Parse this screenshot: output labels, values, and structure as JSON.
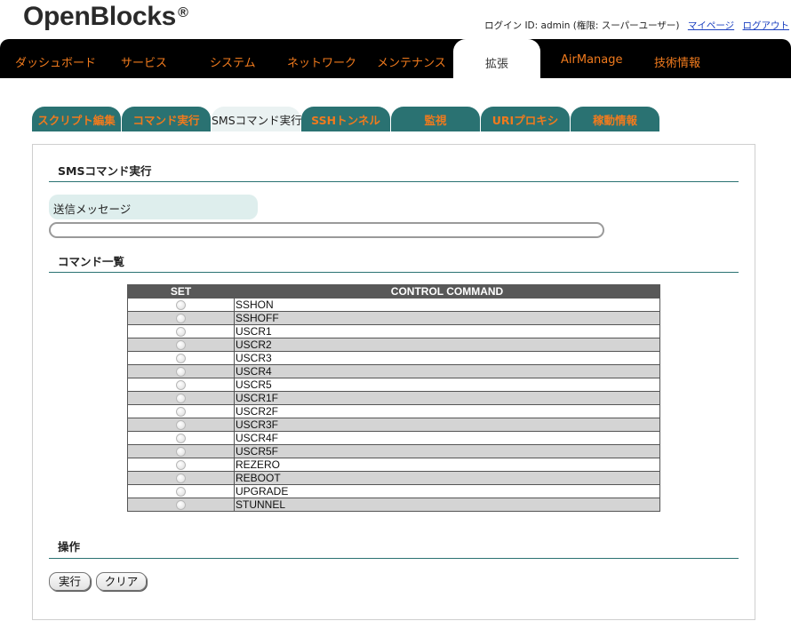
{
  "brand": {
    "name": "OpenBlocks",
    "trademark": "®"
  },
  "user": {
    "login_text": "ログイン ID: admin (権限: スーパーユーザー)",
    "mypage_link": "マイページ",
    "logout_link": "ログアウト"
  },
  "main_nav": {
    "items": [
      {
        "label": "ダッシュボード"
      },
      {
        "label": "サービス"
      },
      {
        "label": "システム"
      },
      {
        "label": "ネットワーク"
      },
      {
        "label": "メンテナンス"
      },
      {
        "label": "拡張"
      },
      {
        "label": "AirManage"
      },
      {
        "label": "技術情報"
      }
    ],
    "active": "拡張"
  },
  "sub_tabs": {
    "items": [
      {
        "label": "スクリプト編集"
      },
      {
        "label": "コマンド実行"
      },
      {
        "label": "SMSコマンド実行"
      },
      {
        "label": "SSHトンネル"
      },
      {
        "label": "監視"
      },
      {
        "label": "URIプロキシ"
      },
      {
        "label": "稼動情報"
      }
    ],
    "active": "SMSコマンド実行"
  },
  "sms_section": {
    "title": "SMSコマンド実行",
    "message_label": "送信メッセージ",
    "message_value": ""
  },
  "command_section": {
    "title": "コマンド一覧",
    "columns": {
      "set": "SET",
      "command": "CONTROL COMMAND"
    },
    "commands": [
      "SSHON",
      "SSHOFF",
      "USCR1",
      "USCR2",
      "USCR3",
      "USCR4",
      "USCR5",
      "USCR1F",
      "USCR2F",
      "USCR3F",
      "USCR4F",
      "USCR5F",
      "REZERO",
      "REBOOT",
      "UPGRADE",
      "STUNNEL"
    ]
  },
  "operation_section": {
    "title": "操作",
    "execute_label": "実行",
    "clear_label": "クリア"
  },
  "colors": {
    "accent_orange": "#f07a1d",
    "teal": "#2a7272",
    "nav_black": "#000000"
  }
}
